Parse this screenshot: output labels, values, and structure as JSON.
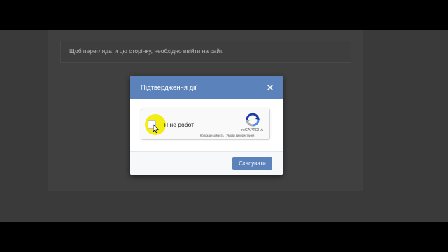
{
  "page": {
    "notice": "Щоб переглядати цю сторінку, необхідно ввійти на сайт."
  },
  "dialog": {
    "title": "Підтвердження дії",
    "close_icon": "close-icon",
    "cancel_label": "Скасувати",
    "accent_color": "#5b82bb"
  },
  "recaptcha": {
    "checkbox_label": "Я не робот",
    "brand": "reCAPTCHA",
    "privacy_link": "Конфіденційність",
    "separator": "-",
    "terms_link": "Умови використання",
    "logo_icon": "recaptcha-logo-icon",
    "checked": false
  },
  "overlay": {
    "cursor_icon": "mouse-cursor-icon",
    "highlight_color": "#f3eb00"
  }
}
